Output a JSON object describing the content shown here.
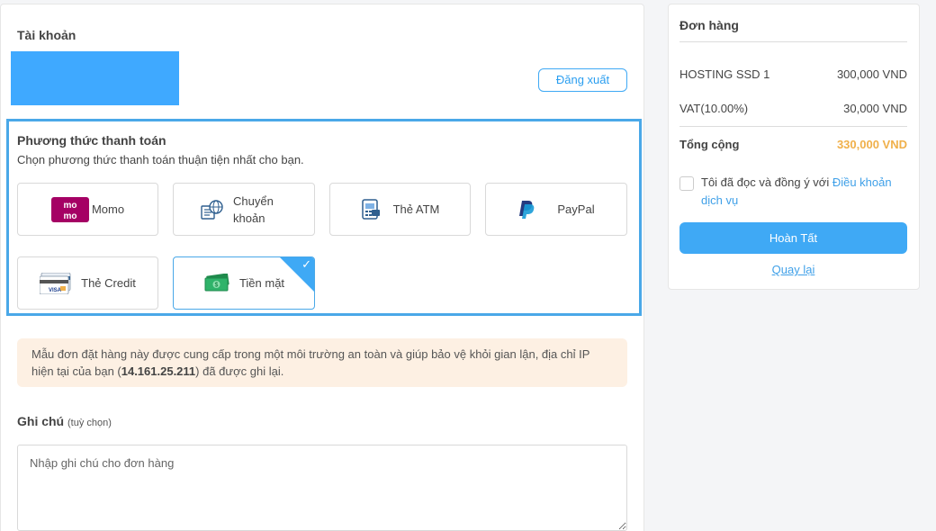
{
  "account": {
    "title": "Tài khoản",
    "logout_label": "Đăng xuất"
  },
  "payment": {
    "title": "Phương thức thanh toán",
    "subtitle": "Chọn phương thức thanh toán thuận tiện nhất cho bạn.",
    "options": [
      {
        "label": "Momo",
        "icon": "momo-logo",
        "selected": false
      },
      {
        "label": "Chuyển khoản",
        "icon": "bank-transfer-icon",
        "selected": false
      },
      {
        "label": "Thẻ ATM",
        "icon": "atm-card-icon",
        "selected": false
      },
      {
        "label": "PayPal",
        "icon": "paypal-icon",
        "selected": false
      },
      {
        "label": "Thẻ Credit",
        "icon": "credit-card-icon",
        "selected": false
      },
      {
        "label": "Tiền mặt",
        "icon": "cash-icon",
        "selected": true
      }
    ],
    "logo_texts": {
      "momo_top": "mo",
      "momo_bottom": "mo",
      "visa": "VISA"
    }
  },
  "notice": {
    "text_before": "Mẫu đơn đặt hàng này được cung cấp trong một môi trường an toàn và giúp bảo vệ khỏi gian lận, địa chỉ IP hiện tại của bạn (",
    "ip": "14.161.25.211",
    "text_after": ") đã được ghi lại."
  },
  "notes": {
    "title": "Ghi chú",
    "optional": "(tuỳ chọn)",
    "placeholder": "Nhập ghi chú cho đơn hàng"
  },
  "order": {
    "title": "Đơn hàng",
    "items": [
      {
        "name": "HOSTING SSD 1",
        "price": "300,000 VND"
      },
      {
        "name": "VAT(10.00%)",
        "price": "30,000 VND"
      }
    ],
    "total_label": "Tổng cộng",
    "total_value": "330,000 VND",
    "terms_text": "Tôi đã đọc và đồng ý với ",
    "terms_link": "Điều khoản dịch vụ",
    "finish_label": "Hoàn Tất",
    "back_label": "Quay lại"
  },
  "colors": {
    "accent": "#3fa9f5",
    "total": "#f0b04a",
    "notice_bg": "#fdf0e3",
    "momo": "#a50064",
    "account_box": "#3fa9ff"
  }
}
